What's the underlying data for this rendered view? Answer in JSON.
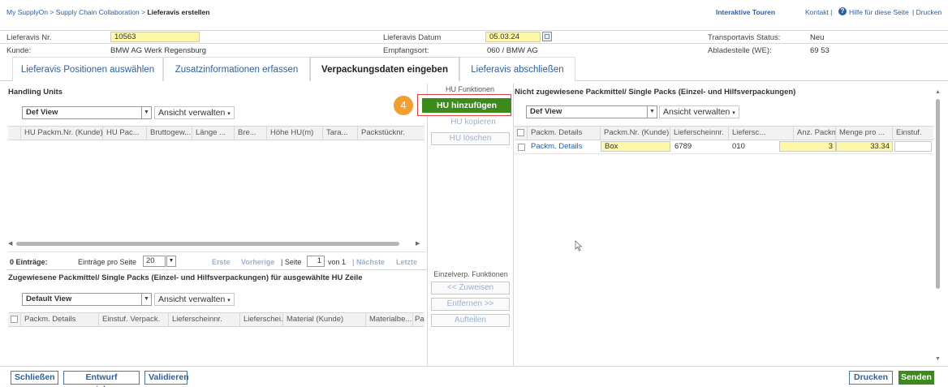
{
  "breadcrumb": {
    "part1": "My SupplyOn",
    "sep1": " > ",
    "part2": "Supply Chain Collaboration",
    "sep2": " > ",
    "current": "Lieferavis erstellen"
  },
  "topnav": {
    "tours": "Interaktive Touren",
    "contact": "Kontakt |",
    "help": "Hilfe für diese Seite",
    "print": "| Drucken"
  },
  "header": {
    "lieferavis_nr_label": "Lieferavis Nr.",
    "lieferavis_nr_value": "10563",
    "datum_label": "Lieferavis Datum",
    "datum_value": "05.03.24",
    "transport_label": "Transportavis Status:",
    "transport_value": "Neu",
    "kunde_label": "Kunde:",
    "kunde_value": "BMW AG Werk Regensburg",
    "empfang_label": "Empfangsort:",
    "empfang_value": "060 / BMW AG",
    "ablade_label": "Abladestelle (WE):",
    "ablade_value": "69 53"
  },
  "tabs": [
    "Lieferavis Positionen auswählen",
    "Zusatzinformationen erfassen",
    "Verpackungsdaten eingeben",
    "Lieferavis abschließen"
  ],
  "hu_panel": {
    "title": "Handling Units",
    "view": "Def View",
    "ansicht": "Ansicht verwalten",
    "columns": [
      "HU Packm.Nr. (Kunde)",
      "HU Pac...",
      "Bruttogew...",
      "Länge ...",
      "Bre...",
      "Höhe HU(m)",
      "Tara...",
      "Packstücknr."
    ],
    "entries": "0 Einträge:",
    "per_page_label": "Einträge pro Seite",
    "per_page": "20",
    "first": "Erste",
    "prev": "Vorherige",
    "page_label": "| Seite",
    "page": "1",
    "of": "von 1",
    "next": "| Nächste",
    "last": "Letzte"
  },
  "hu_functions": {
    "title": "HU Funktionen",
    "add": "HU hinzufügen",
    "copy": "HU kopieren",
    "delete": "HU löschen",
    "step": "4"
  },
  "assigned_panel": {
    "title": "Zugewiesene Packmittel/ Single Packs (Einzel- und Hilfsverpackungen) für ausgewählte HU Zeile",
    "view": "Default View",
    "ansicht": "Ansicht verwalten",
    "columns": [
      "Packm. Details",
      "Einstuf. Verpack.",
      "Lieferscheinnr.",
      "Lieferschei...",
      "Material (Kunde)",
      "Materialbe...",
      "Pa"
    ]
  },
  "single_functions": {
    "title": "Einzelverp. Funktionen",
    "assign": "<< Zuweisen",
    "remove": "Entfernen >>",
    "split": "Aufteilen"
  },
  "unassigned_panel": {
    "title": "Nicht zugewiesene Packmittel/ Single Packs (Einzel- und Hilfsverpackungen)",
    "view": "Def View",
    "ansicht": "Ansicht verwalten",
    "columns": [
      "Packm. Details",
      "Packm.Nr. (Kunde)",
      "Lieferscheinnr.",
      "Liefersc...",
      "Anz. Packm.",
      "Menge pro ...",
      "Einstuf."
    ],
    "row": {
      "details": "Packm. Details",
      "packm": "Box",
      "lieferschein": "6789",
      "pos": "010",
      "anz": "3",
      "menge": "33.34"
    }
  },
  "footer": {
    "close": "Schließen",
    "save_draft": "Entwurf speichern",
    "validate": "Validieren",
    "print": "Drucken",
    "send": "Senden"
  },
  "colors": {
    "accent": "#3c8a1c",
    "link": "#2a5fa8",
    "highlight": "#fdf8a8",
    "step": "#f0a030"
  }
}
